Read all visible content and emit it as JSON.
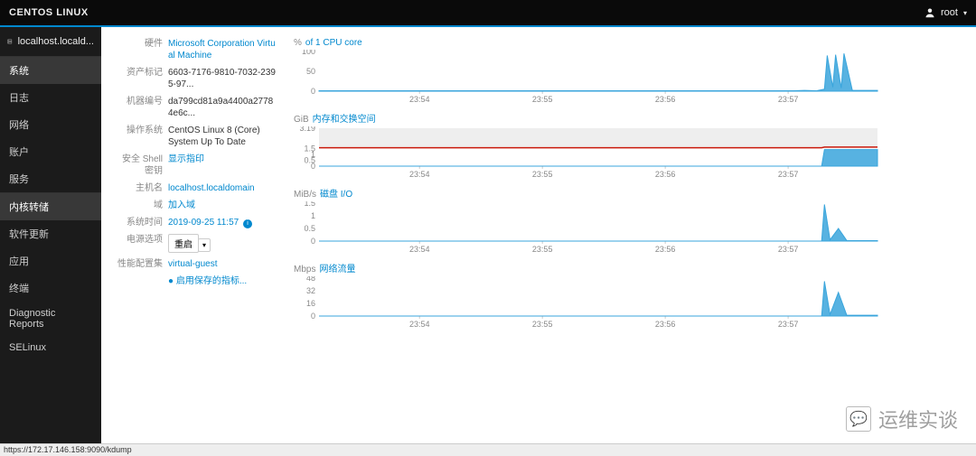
{
  "topbar": {
    "title": "CENTOS LINUX",
    "user": "root"
  },
  "sidebar": {
    "host": "localhost.locald...",
    "items": [
      "系统",
      "日志",
      "网络",
      "账户",
      "服务"
    ],
    "items2": [
      "内核转储",
      "软件更新",
      "应用",
      "终端",
      "Diagnostic Reports",
      "SELinux"
    ]
  },
  "info": {
    "hardware_label": "硬件",
    "hardware": "Microsoft Corporation Virtual Machine",
    "assettag_label": "资产标记",
    "assettag": "6603-7176-9810-7032-2395-97...",
    "machineid_label": "机器编号",
    "machineid": "da799cd81a9a4400a27784e6c...",
    "os_label": "操作系统",
    "os": "CentOS Linux 8 (Core)",
    "os_status": "System Up To Date",
    "ssh_label": "安全 Shell 密钥",
    "ssh": "显示指印",
    "hostname_label": "主机名",
    "hostname": "localhost.localdomain",
    "domain_label": "域",
    "domain": "加入域",
    "time_label": "系统时间",
    "time": "2019-09-25 11:57",
    "power_label": "电源选项",
    "power": "重启",
    "perf_label": "性能配置集",
    "perf": "virtual-guest",
    "save_link": "● 启用保存的指标..."
  },
  "chart_data": [
    {
      "type": "area",
      "unit": "%",
      "title": "of 1 CPU core",
      "ylim": [
        0,
        100
      ],
      "yticks": [
        0,
        50,
        100
      ],
      "xticks": [
        "23:54",
        "23:55",
        "23:56",
        "23:57"
      ],
      "height": 60,
      "series": [
        {
          "name": "cpu",
          "color": "#39a5dc",
          "points": [
            [
              0,
              1
            ],
            [
              0.85,
              1
            ],
            [
              0.87,
              2
            ],
            [
              0.89,
              1
            ],
            [
              0.905,
              5
            ],
            [
              0.91,
              90
            ],
            [
              0.92,
              10
            ],
            [
              0.925,
              92
            ],
            [
              0.935,
              8
            ],
            [
              0.94,
              95
            ],
            [
              0.955,
              2
            ],
            [
              1.0,
              2
            ]
          ]
        }
      ]
    },
    {
      "type": "area",
      "unit": "GiB",
      "title": "内存和交换空间",
      "ylim": [
        0,
        3.19
      ],
      "yticks": [
        0,
        0.5,
        1,
        1.5,
        3.19
      ],
      "xticks": [
        "23:54",
        "23:55",
        "23:56",
        "23:57"
      ],
      "height": 58,
      "bg_band": [
        1.5,
        3.19
      ],
      "series": [
        {
          "name": "swap",
          "color": "#c9190b",
          "line_only": true,
          "points": [
            [
              0,
              1.55
            ],
            [
              0.9,
              1.55
            ],
            [
              0.905,
              1.6
            ],
            [
              1.0,
              1.6
            ]
          ]
        },
        {
          "name": "mem",
          "color": "#39a5dc",
          "points": [
            [
              0,
              0
            ],
            [
              0.9,
              0
            ],
            [
              0.905,
              1.4
            ],
            [
              1.0,
              1.4
            ]
          ]
        }
      ]
    },
    {
      "type": "area",
      "unit": "MiB/s",
      "title": "磁盘 I/O",
      "ylim": [
        0,
        1.5
      ],
      "yticks": [
        0,
        0.5,
        1,
        1.5
      ],
      "xticks": [
        "23:54",
        "23:55",
        "23:56",
        "23:57"
      ],
      "height": 58,
      "series": [
        {
          "name": "disk",
          "color": "#39a5dc",
          "points": [
            [
              0,
              0
            ],
            [
              0.9,
              0
            ],
            [
              0.905,
              1.45
            ],
            [
              0.915,
              0.05
            ],
            [
              0.93,
              0.5
            ],
            [
              0.945,
              0.02
            ],
            [
              1.0,
              0.02
            ]
          ]
        }
      ]
    },
    {
      "type": "area",
      "unit": "Mbps",
      "title": "网络流量",
      "ylim": [
        0,
        48
      ],
      "yticks": [
        0,
        16,
        32,
        48
      ],
      "xticks": [
        "23:54",
        "23:55",
        "23:56",
        "23:57"
      ],
      "height": 58,
      "series": [
        {
          "name": "net",
          "color": "#39a5dc",
          "points": [
            [
              0,
              0
            ],
            [
              0.9,
              0
            ],
            [
              0.905,
              44
            ],
            [
              0.915,
              2
            ],
            [
              0.93,
              30
            ],
            [
              0.945,
              1
            ],
            [
              1.0,
              1
            ]
          ]
        }
      ]
    }
  ],
  "status_url": "https://172.17.146.158:9090/kdump",
  "watermark": "运维实谈"
}
